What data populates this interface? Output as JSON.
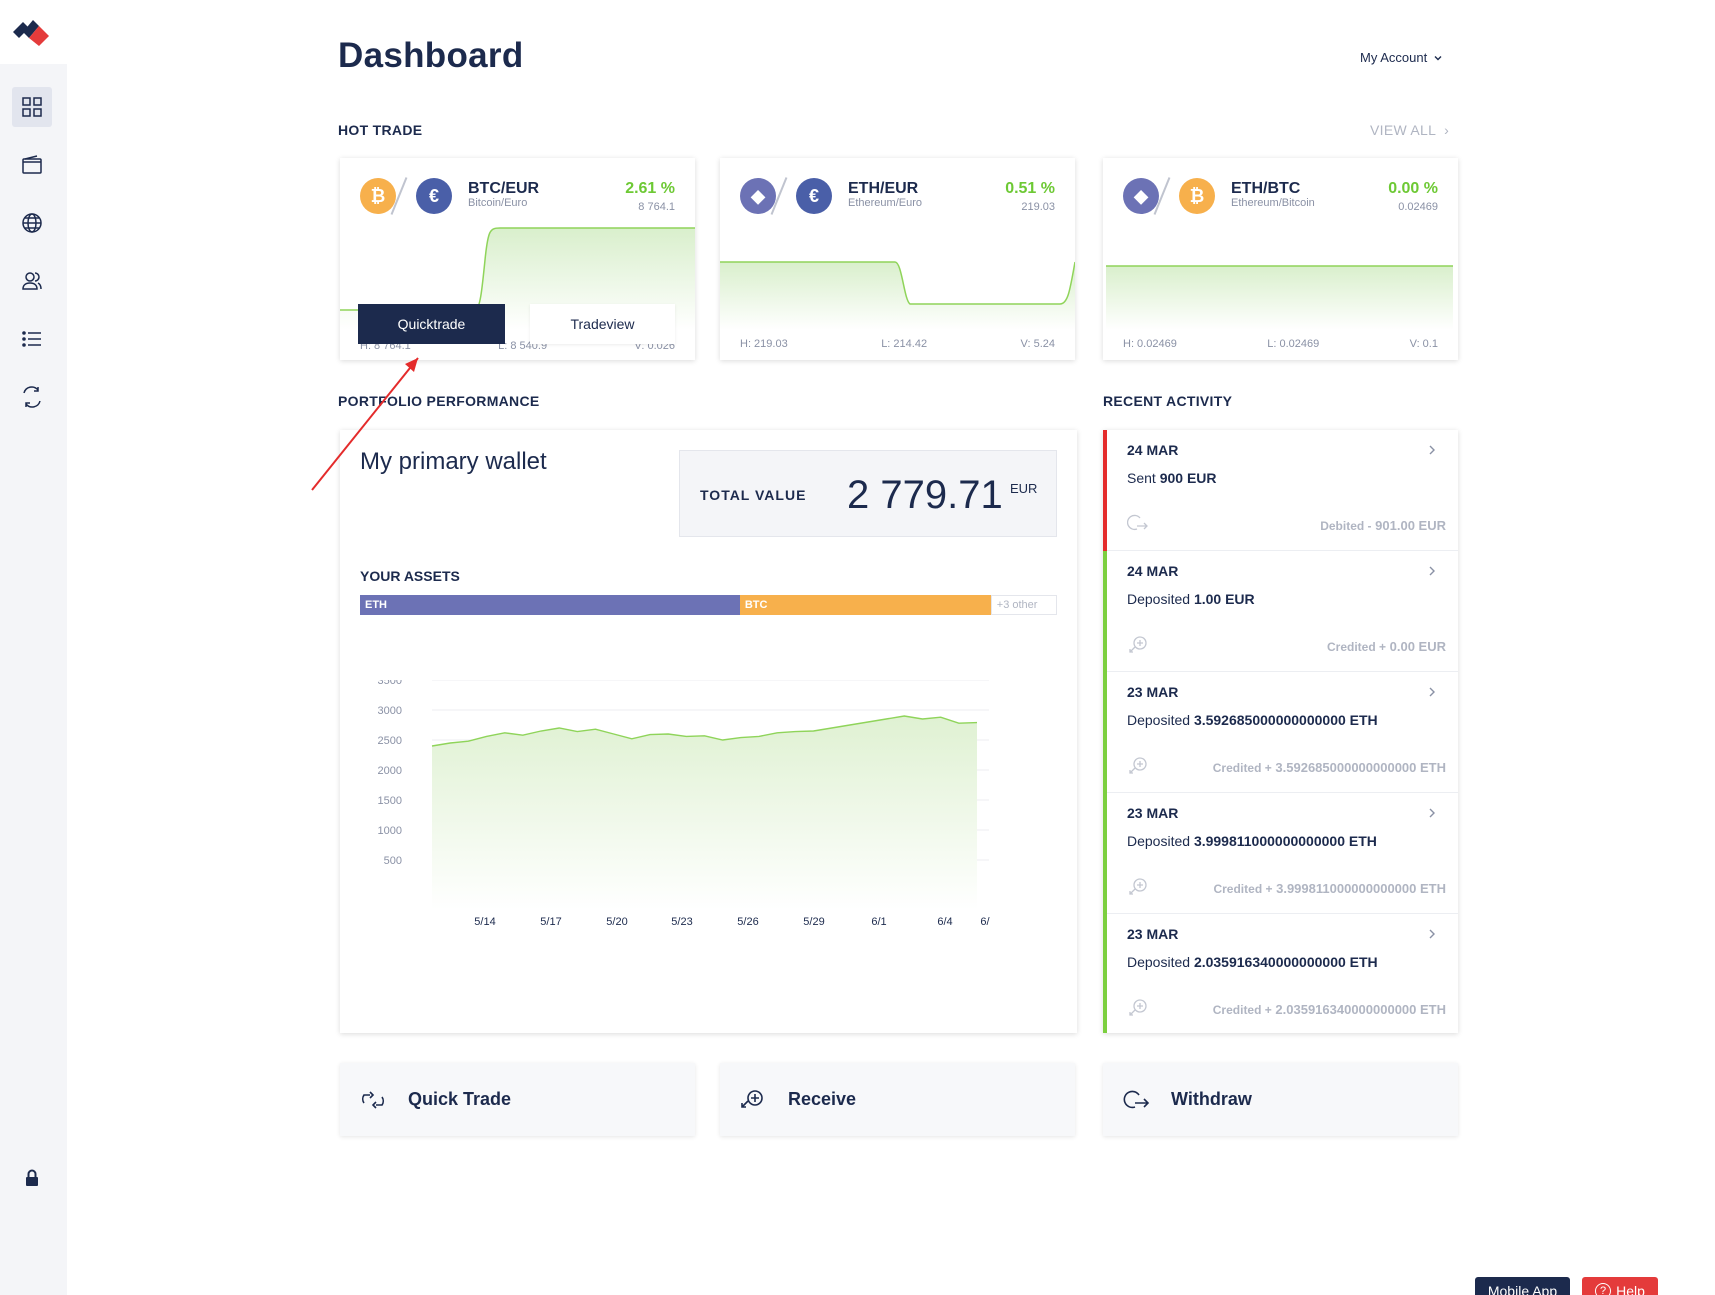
{
  "page": {
    "title": "Dashboard"
  },
  "header": {
    "account_label": "My Account"
  },
  "sidebar": {
    "items": [
      {
        "name": "dashboard",
        "icon": "grid-icon",
        "active": true
      },
      {
        "name": "wallet",
        "icon": "wallet-icon"
      },
      {
        "name": "markets",
        "icon": "globe-icon"
      },
      {
        "name": "contacts",
        "icon": "users-icon"
      },
      {
        "name": "list",
        "icon": "list-icon"
      },
      {
        "name": "exchange",
        "icon": "exchange-icon"
      }
    ],
    "lock_icon": "lock-icon"
  },
  "hot_trade": {
    "label": "HOT TRADE",
    "view_all": "VIEW ALL",
    "cards": [
      {
        "pair": "BTC/EUR",
        "sub": "Bitcoin/Euro",
        "pct": "2.61 %",
        "price": "8 764.1",
        "high": "H: 8 764.1",
        "low": "L: 8 540.9",
        "vol": "V: 0.026",
        "quicktrade": "Quicktrade",
        "tradeview": "Tradeview"
      },
      {
        "pair": "ETH/EUR",
        "sub": "Ethereum/Euro",
        "pct": "0.51 %",
        "price": "219.03",
        "high": "H: 219.03",
        "low": "L: 214.42",
        "vol": "V: 5.24"
      },
      {
        "pair": "ETH/BTC",
        "sub": "Ethereum/Bitcoin",
        "pct": "0.00 %",
        "price": "0.02469",
        "high": "H: 0.02469",
        "low": "L: 0.02469",
        "vol": "V: 0.1"
      }
    ]
  },
  "portfolio": {
    "label": "PORTFOLIO PERFORMANCE",
    "wallet_name": "My primary wallet",
    "total_label": "TOTAL VALUE",
    "total_value": "2 779.71",
    "currency": "EUR",
    "assets_label": "YOUR ASSETS",
    "assets": [
      {
        "name": "ETH",
        "share": 0.545,
        "color": "#6c72b5"
      },
      {
        "name": "BTC",
        "share": 0.36,
        "color": "#f7b04c"
      },
      {
        "name": "+3 other",
        "share": 0.095,
        "color": "#ffffff"
      }
    ]
  },
  "chart_data": {
    "type": "area",
    "x": [
      "5/14",
      "5/17",
      "5/20",
      "5/23",
      "5/26",
      "5/29",
      "6/1",
      "6/4",
      "6/"
    ],
    "y_ticks": [
      500,
      1000,
      1500,
      2000,
      2500,
      3000,
      3500
    ],
    "ylim": [
      0,
      3500
    ],
    "values": [
      2400,
      2450,
      2480,
      2560,
      2620,
      2580,
      2650,
      2700,
      2640,
      2680,
      2600,
      2520,
      2590,
      2600,
      2560,
      2570,
      2500,
      2540,
      2560,
      2620,
      2640,
      2650,
      2700,
      2750,
      2800,
      2850,
      2900,
      2850,
      2880,
      2780,
      2790
    ],
    "line_color": "#8fd45a",
    "fill_color": "#e9f6df"
  },
  "activity": {
    "label": "RECENT ACTIVITY",
    "items": [
      {
        "date": "24 MAR",
        "verb": "Sent",
        "amount": "900 EUR",
        "note_label": "Debited -",
        "note_value": "901.00 EUR",
        "color": "#e42b2b",
        "icon": "withdraw-icon"
      },
      {
        "date": "24 MAR",
        "verb": "Deposited",
        "amount": "1.00 EUR",
        "note_label": "Credited +",
        "note_value": "0.00 EUR",
        "color": "#7ccf3f",
        "icon": "receive-icon"
      },
      {
        "date": "23 MAR",
        "verb": "Deposited",
        "amount": "3.592685000000000000 ETH",
        "note_label": "Credited +",
        "note_value": "3.592685000000000000 ETH",
        "color": "#7ccf3f",
        "icon": "receive-icon"
      },
      {
        "date": "23 MAR",
        "verb": "Deposited",
        "amount": "3.999811000000000000 ETH",
        "note_label": "Credited +",
        "note_value": "3.999811000000000000 ETH",
        "color": "#7ccf3f",
        "icon": "receive-icon"
      },
      {
        "date": "23 MAR",
        "verb": "Deposited",
        "amount": "2.035916340000000000 ETH",
        "note_label": "Credited +",
        "note_value": "2.035916340000000000 ETH",
        "color": "#7ccf3f",
        "icon": "receive-icon"
      }
    ]
  },
  "actions": [
    {
      "label": "Quick Trade",
      "icon": "quick-trade-icon"
    },
    {
      "label": "Receive",
      "icon": "receive-icon"
    },
    {
      "label": "Withdraw",
      "icon": "withdraw-icon"
    }
  ],
  "footer": {
    "mobile_app": "Mobile App",
    "help": "Help"
  },
  "colors": {
    "navy": "#1c2a4d",
    "green": "#6dc934",
    "red": "#e43b3b",
    "eth": "#6c72b5",
    "btc": "#f7b04c",
    "eur": "#4a5fa8"
  }
}
